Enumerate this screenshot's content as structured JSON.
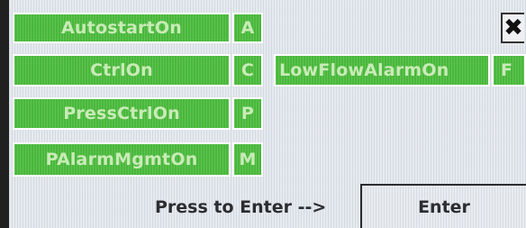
{
  "buttons": [
    {
      "label": "AutostartOn",
      "key": "A"
    },
    {
      "label": "CtrlOn",
      "key": "C"
    },
    {
      "label": "PressCtrlOn",
      "key": "P"
    },
    {
      "label": "PAlarmMgmtOn",
      "key": "M"
    }
  ],
  "alarm": {
    "label": "LowFlowAlarmOn",
    "key": "F"
  },
  "close_icon": "x-close-icon",
  "bottom": {
    "prompt": "Press to Enter -->",
    "enter_label": "Enter"
  },
  "colors": {
    "button_green": "#48b83a",
    "button_text": "#c9ebb7",
    "background": "#e4e9ee"
  }
}
